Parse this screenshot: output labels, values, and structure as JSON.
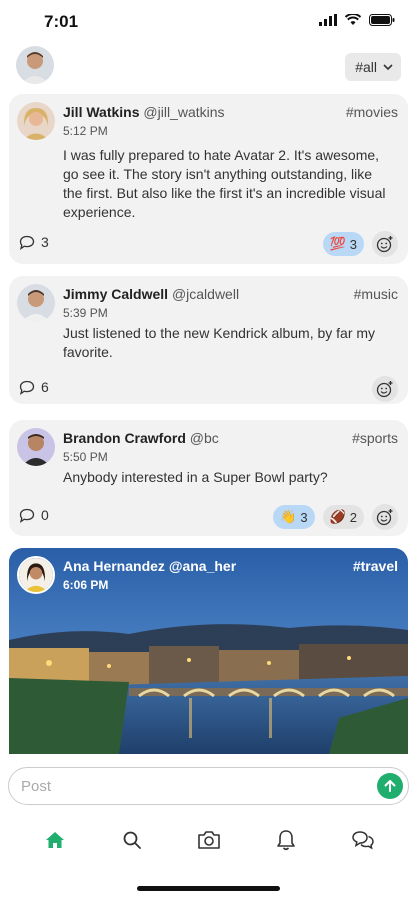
{
  "status": {
    "time": "7:01",
    "icons": [
      "signal-icon",
      "wifi-icon",
      "battery-icon"
    ]
  },
  "header": {
    "filter_label": "#all"
  },
  "posts": [
    {
      "name": "Jill Watkins",
      "handle": "@jill_watkins",
      "tag": "#movies",
      "time": "5:12 PM",
      "text": "I was fully prepared to hate Avatar 2. It's awesome, go see it. The story isn't anything outstanding, like the first. But also like the first it's an incredible visual experience.",
      "comments": "3",
      "reactions": [
        {
          "emoji": "💯",
          "count": "3",
          "active": true
        }
      ]
    },
    {
      "name": "Jimmy Caldwell",
      "handle": "@jcaldwell",
      "tag": "#music",
      "time": "5:39 PM",
      "text": "Just listened to the new Kendrick album, by far my favorite.",
      "comments": "6",
      "reactions": []
    },
    {
      "name": "Brandon Crawford",
      "handle": "@bc",
      "tag": "#sports",
      "time": "5:50 PM",
      "text": "Anybody interested in a Super Bowl party?",
      "comments": "0",
      "reactions": [
        {
          "emoji": "👋",
          "count": "3",
          "active": true
        },
        {
          "emoji": "🏈",
          "count": "2",
          "active": false
        }
      ]
    },
    {
      "name": "Ana Hernandez",
      "handle": "@ana_her",
      "tag": "#travel",
      "time": "6:06 PM"
    }
  ],
  "composer": {
    "placeholder": "Post"
  },
  "tabs": [
    "home-icon",
    "search-icon",
    "camera-icon",
    "bell-icon",
    "chat-icon"
  ],
  "colors": {
    "accent": "#1fae6e",
    "card": "#f2f2f2",
    "reaction_active": "#b8d8f5"
  }
}
